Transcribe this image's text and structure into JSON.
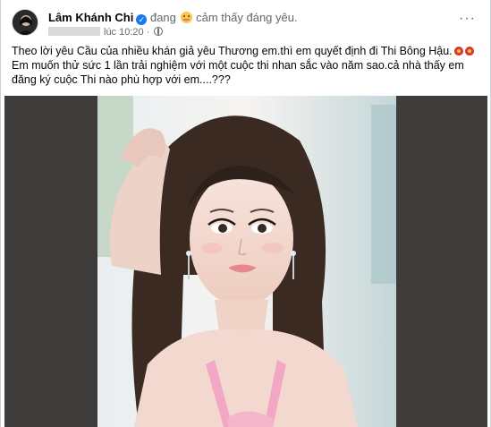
{
  "post": {
    "author": "Lâm Khánh Chi",
    "status_prefix": "đang",
    "feeling": "cảm thấy đáng yêu.",
    "time": "lúc 10:20",
    "time_separator": "·",
    "more_label": "···",
    "text": [
      "Theo lời yêu Cầu của nhiều khán giả yêu Thương em.thì em quyết định đi Thi Bông Hậu.",
      "Em muốn thử sức 1 lần trải nghiệm với một cuộc thi nhan sắc vào năm sao.cả nhà thấy em đăng ký cuộc Thi nào phù hợp với em....???"
    ],
    "icons": {
      "verified": "verified-badge-icon",
      "feeling": "smiling-emoji-icon",
      "privacy": "globe-icon",
      "decorations": "flower-emoji-icon"
    },
    "colors": {
      "verified": "#1877f2",
      "muted_text": "#65676b",
      "media_background": "#3f3d3c"
    }
  }
}
